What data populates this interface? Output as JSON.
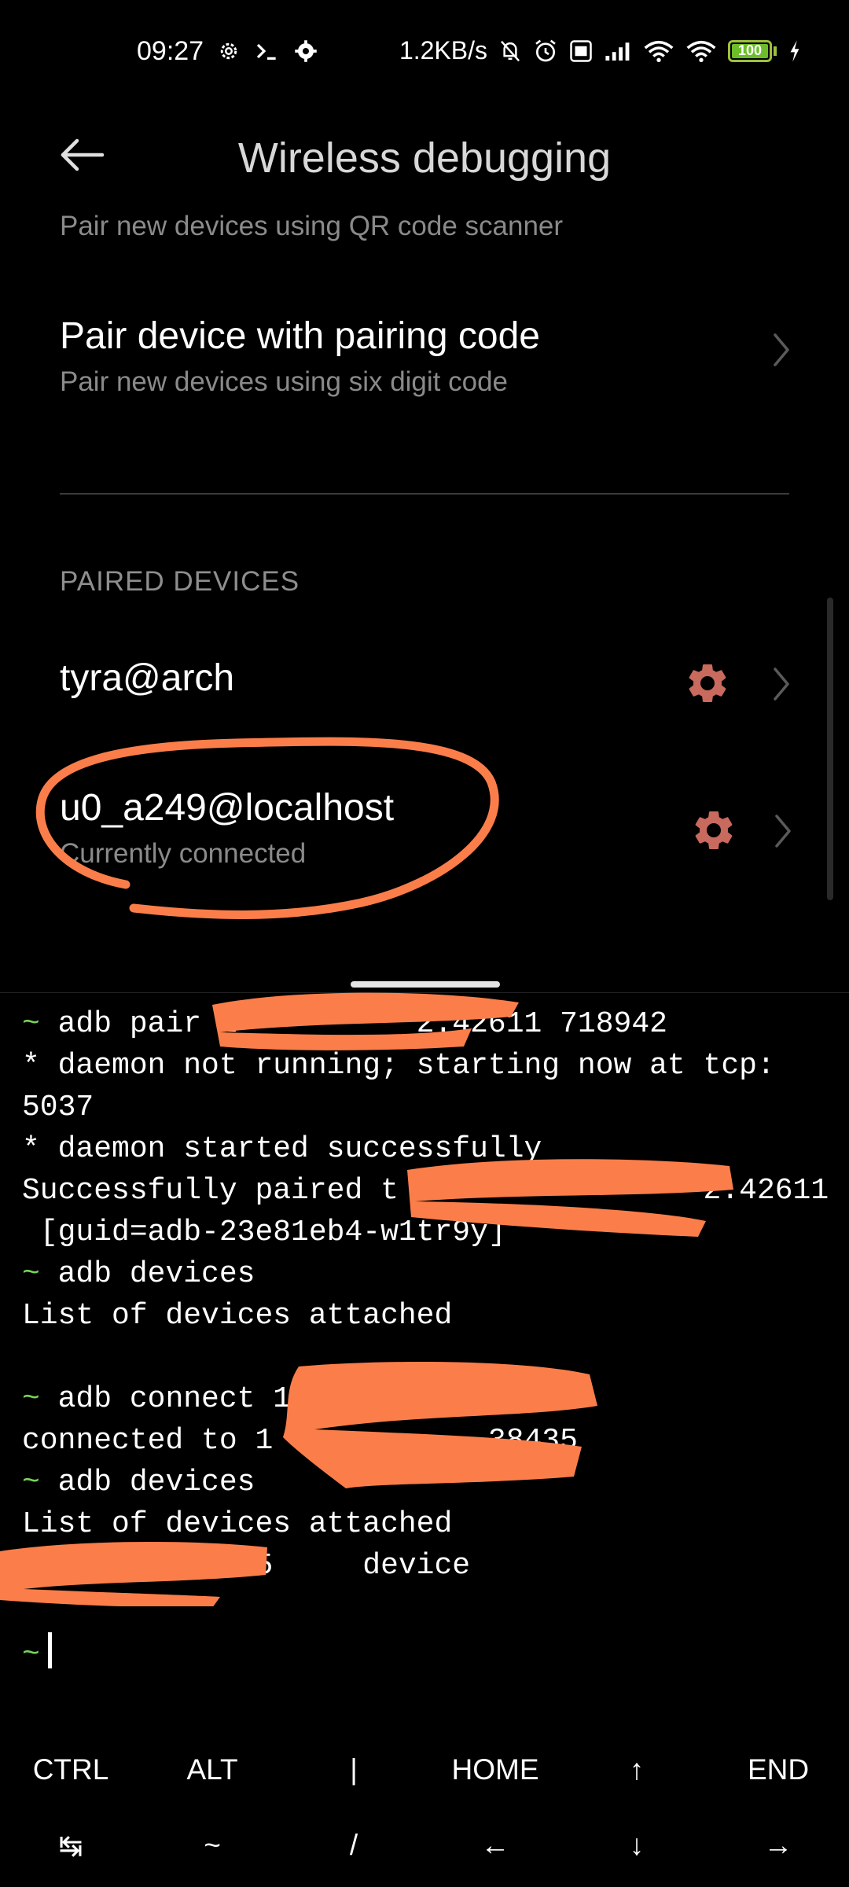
{
  "status_bar": {
    "time": "09:27",
    "net_speed": "1.2KB/s",
    "battery_level": "100",
    "icons": [
      "settings-icon",
      "terminal-icon",
      "gear-icon",
      "mute-icon",
      "alarm-icon",
      "volte-icon",
      "signal-icon",
      "wifi-icon",
      "wifi-icon",
      "battery-icon",
      "charging-icon"
    ]
  },
  "settings": {
    "title": "Wireless debugging",
    "qr_item": {
      "subtitle": "Pair new devices using QR code scanner"
    },
    "pair_code_item": {
      "title": "Pair device with pairing code",
      "subtitle": "Pair new devices using six digit code"
    },
    "paired_section_label": "PAIRED DEVICES",
    "paired_devices": [
      {
        "name": "tyra@arch",
        "status": ""
      },
      {
        "name": "u0_a249@localhost",
        "status": "Currently connected"
      }
    ],
    "accent_color": "#c86a5e",
    "annotation_color": "#fb7e4a"
  },
  "terminal": {
    "prompt_symbol": "~",
    "lines": [
      {
        "prompt": true,
        "text": "adb pair 1          2.42611 718942"
      },
      {
        "prompt": false,
        "text": "* daemon not running; starting now at tcp:"
      },
      {
        "prompt": false,
        "text": "5037"
      },
      {
        "prompt": false,
        "text": "* daemon started successfully"
      },
      {
        "prompt": false,
        "text": "Successfully paired t                 2.42611"
      },
      {
        "prompt": false,
        "text": " [guid=adb-23e81eb4-w1tr9y]"
      },
      {
        "prompt": true,
        "text": "adb devices"
      },
      {
        "prompt": false,
        "text": "List of devices attached"
      },
      {
        "prompt": false,
        "text": ""
      },
      {
        "prompt": true,
        "text": "adb connect 1             8435"
      },
      {
        "prompt": false,
        "text": "connected to 1            38435"
      },
      {
        "prompt": true,
        "text": "adb devices"
      },
      {
        "prompt": false,
        "text": "List of devices attached"
      },
      {
        "prompt": false,
        "text": "        :38435     device"
      },
      {
        "prompt": false,
        "text": ""
      },
      {
        "prompt": true,
        "text": ""
      }
    ]
  },
  "extra_keys": {
    "row1": [
      "CTRL",
      "ALT",
      "|",
      "HOME",
      "↑",
      "END"
    ],
    "row2": [
      "↹",
      "~",
      "/",
      "←",
      "↓",
      "→"
    ]
  }
}
